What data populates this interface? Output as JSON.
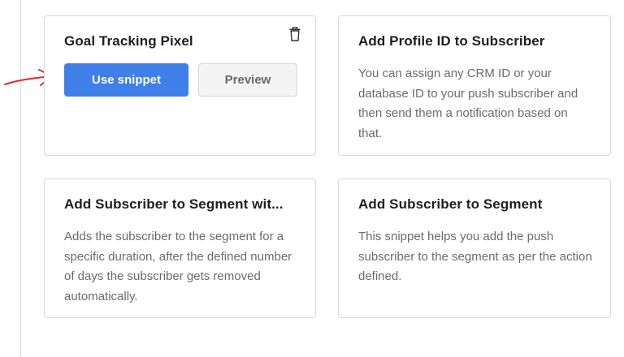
{
  "colors": {
    "primary_button": "#3f7fe8",
    "annotation_arrow": "#e0282e",
    "card_border": "#d9d9d9"
  },
  "snippets": [
    {
      "title": "Goal Tracking Pixel",
      "actions": {
        "use_label": "Use snippet",
        "preview_label": "Preview"
      },
      "delete_icon": "trash-icon"
    },
    {
      "title": "Add Profile ID to Subscriber",
      "description": "You can assign any CRM ID or your database ID to your push subscriber and then send them a notification based on that."
    },
    {
      "title": "Add Subscriber to Segment wit...",
      "description": "Adds the subscriber to the segment for a specific duration, after the defined number of days the subscriber gets removed automatically."
    },
    {
      "title": "Add Subscriber to Segment",
      "description": "This snippet helps you add the push subscriber to the segment as per the action defined."
    }
  ]
}
